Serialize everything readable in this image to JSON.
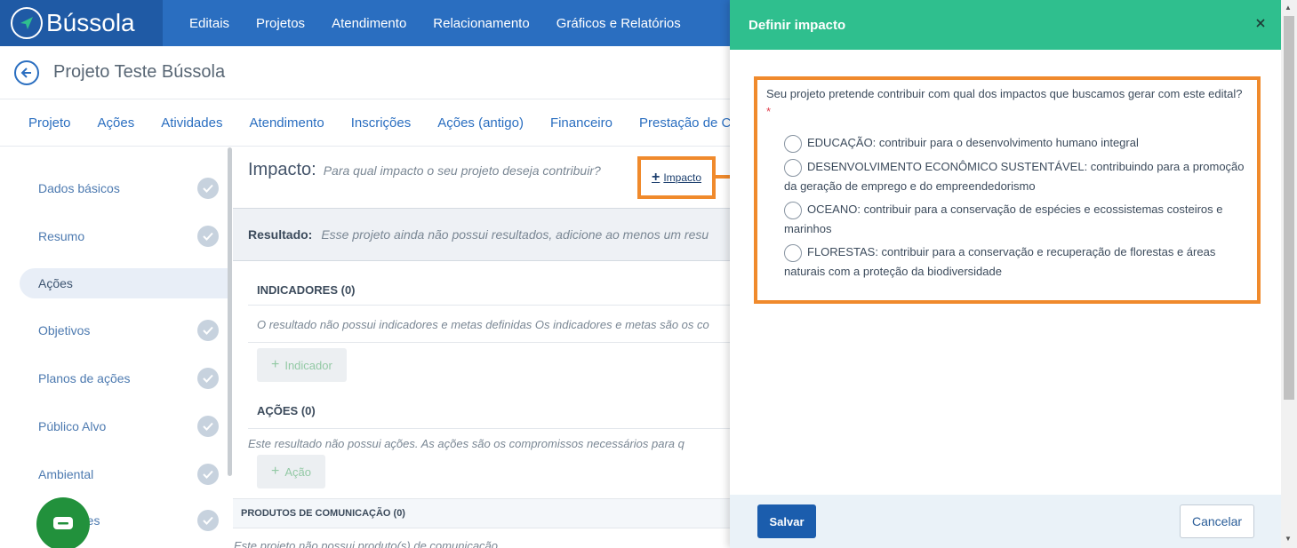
{
  "brand": {
    "name": "Bússola"
  },
  "topnav": [
    "Editais",
    "Projetos",
    "Atendimento",
    "Relacionamento",
    "Gráficos e Relatórios"
  ],
  "project": {
    "title": "Projeto Teste Bússola"
  },
  "tabs": [
    "Projeto",
    "Ações",
    "Atividades",
    "Atendimento",
    "Inscrições",
    "Ações (antigo)",
    "Financeiro",
    "Prestação de Cont"
  ],
  "sidebar": {
    "items": [
      {
        "label": "Dados básicos",
        "checked": true
      },
      {
        "label": "Resumo",
        "checked": true
      },
      {
        "label": "Ações",
        "checked": false,
        "active": true
      },
      {
        "label": "Objetivos",
        "checked": true
      },
      {
        "label": "Planos de ações",
        "checked": true
      },
      {
        "label": "Público Alvo",
        "checked": true
      },
      {
        "label": "Ambiental",
        "checked": true
      },
      {
        "label": "res",
        "checked": true
      }
    ]
  },
  "main": {
    "impact_label": "Impacto:",
    "impact_hint": "Para qual impacto o seu projeto deseja contribuir?",
    "impact_button": "Impacto",
    "result_label": "Resultado:",
    "result_hint": "Esse projeto ainda não possui resultados, adicione ao menos um resu",
    "indicators_title": "INDICADORES (0)",
    "indicators_note": "O resultado não possui indicadores e metas definidas Os indicadores e metas são os co",
    "indicator_button": "Indicador",
    "actions_title": "AÇÕES (0)",
    "actions_note": "Este resultado não possui ações. As ações são os compromissos necessários para q",
    "action_button": "Ação",
    "products_title": "PRODUTOS DE COMUNICAÇÃO (0)",
    "products_note": "Este projeto não possui produto(s) de comunicação"
  },
  "panel": {
    "title": "Definir impacto",
    "question": "Seu projeto pretende contribuir com qual dos impactos que buscamos gerar com este edital?",
    "required_mark": "*",
    "options": [
      "EDUCAÇÃO: contribuir para o desenvolvimento humano integral",
      "DESENVOLVIMENTO ECONÔMICO SUSTENTÁVEL: contribuindo para a promoção da geração de emprego e do empreendedorismo",
      "OCEANO: contribuir para a conservação de espécies e ecossistemas costeiros e marinhos",
      "FLORESTAS: contribuir para a conservação e recuperação de florestas e áreas naturais com a proteção da biodiversidade"
    ],
    "save_label": "Salvar",
    "cancel_label": "Cancelar"
  },
  "colors": {
    "nav_blue": "#2a6ec0",
    "panel_green": "#2fbf8e",
    "highlight_orange": "#f08a2c",
    "save_blue": "#1b5dad"
  }
}
